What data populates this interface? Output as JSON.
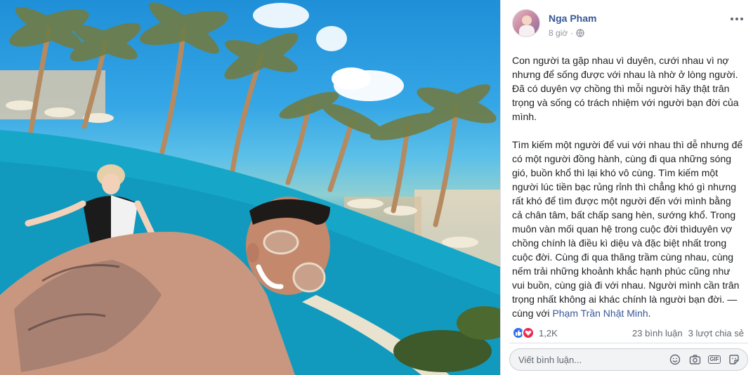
{
  "post": {
    "author": "Nga Pham",
    "time": "8 giờ",
    "dot": "·",
    "paragraphs": [
      "Con người ta gặp nhau vì duyên, cưới nhau vì nợ nhưng để sống được với nhau là nhờ ở lòng người. Đã có duyên vợ chồng thì mỗi người hãy thật trân trọng và sống có trách nhiệm với người bạn đời của mình.",
      "Tìm kiếm một người để vui với nhau thì dễ nhưng để có một người đồng hành, cùng đi qua những sóng gió, buồn khổ thì lại khó vô cùng. Tìm kiếm một người lúc tiền bạc rủng rỉnh thì chẳng khó gì nhưng rất khó để tìm được một người đến với mình bằng cả chân tâm, bất chấp sang hèn, sướng khổ. Trong muôn vàn mối quan hệ trong cuộc đời thìduyên vợ chồng chính là điều kì diệu và đặc biệt nhất trong cuộc đời. Cùng đi qua thăng trầm cùng nhau, cùng nếm trải những khoảnh khắc hạnh phúc cũng như vui buồn, cùng già đi với nhau. Người mình cần trân trọng nhất không ai khác chính là người bạn đời."
    ],
    "with_text": " — cùng với ",
    "tagged_name": "Phạm Trần Nhật Minh",
    "tagged_end": "."
  },
  "reactions": {
    "count": "1,2K",
    "comments": "23 bình luận",
    "shares": "3 lượt chia sẻ"
  },
  "comment": {
    "placeholder": "Viết bình luận..."
  },
  "icons": {
    "privacy": "globe-icon",
    "menu": "more-options-icon",
    "tools": [
      "emoji-icon",
      "camera-icon",
      "gif-icon",
      "sticker-icon"
    ]
  },
  "colors": {
    "link": "#385898",
    "like": "#2e6ff3",
    "love": "#f0284a"
  }
}
